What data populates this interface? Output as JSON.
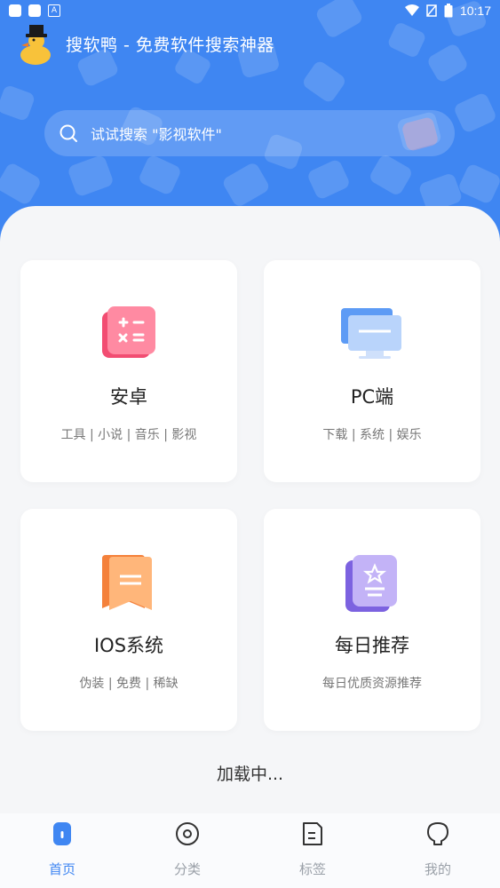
{
  "status": {
    "time": "10:17"
  },
  "app": {
    "title": "搜软鸭 - 免费软件搜索神器"
  },
  "search": {
    "placeholder": "试试搜索 \"影视软件\""
  },
  "cards": [
    {
      "title": "安卓",
      "subtitle": "工具 | 小说 | 音乐 | 影视",
      "icon": "calculator-icon"
    },
    {
      "title": "PC端",
      "subtitle": "下载 | 系统 | 娱乐",
      "icon": "monitor-icon"
    },
    {
      "title": "IOS系统",
      "subtitle": "伪装 | 免费 | 稀缺",
      "icon": "bookmark-icon"
    },
    {
      "title": "每日推荐",
      "subtitle": "每日优质资源推荐",
      "icon": "star-badge-icon"
    }
  ],
  "loading": "加载中...",
  "tabs": [
    {
      "label": "首页",
      "icon": "home-icon",
      "active": true
    },
    {
      "label": "分类",
      "icon": "category-icon",
      "active": false
    },
    {
      "label": "标签",
      "icon": "tag-icon",
      "active": false
    },
    {
      "label": "我的",
      "icon": "profile-icon",
      "active": false
    }
  ],
  "colors": {
    "primary": "#3f86f2",
    "inactive": "#9aa0a8"
  }
}
